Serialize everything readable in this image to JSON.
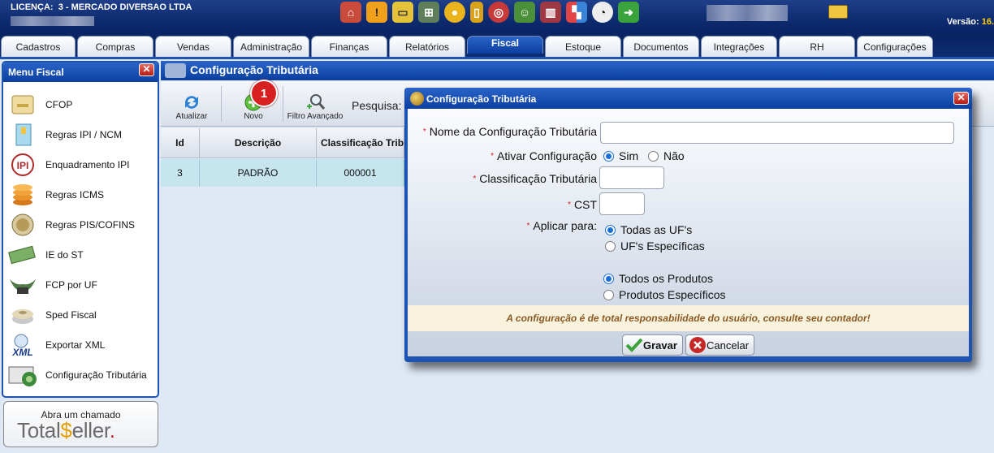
{
  "header": {
    "license_label": "LICENÇA:",
    "license_value": "3 - MERCADO DIVERSAO LTDA",
    "version_label": "Versão:",
    "version_value": "16."
  },
  "tabs": [
    {
      "label": "Cadastros"
    },
    {
      "label": "Compras"
    },
    {
      "label": "Vendas"
    },
    {
      "label": "Administração"
    },
    {
      "label": "Finanças"
    },
    {
      "label": "Relatórios"
    },
    {
      "label": "Fiscal"
    },
    {
      "label": "Estoque"
    },
    {
      "label": "Documentos"
    },
    {
      "label": "Integrações"
    },
    {
      "label": "RH"
    },
    {
      "label": "Configurações"
    }
  ],
  "active_tab": "Fiscal",
  "menu": {
    "title": "Menu Fiscal",
    "items": [
      {
        "label": "CFOP",
        "icon": "folder-icon"
      },
      {
        "label": "Regras IPI / NCM",
        "icon": "document-icon"
      },
      {
        "label": "Enquadramento IPI",
        "icon": "ipi-icon"
      },
      {
        "label": "Regras ICMS",
        "icon": "coins-icon"
      },
      {
        "label": "Regras PIS/COFINS",
        "icon": "coin-icon"
      },
      {
        "label": "IE do ST",
        "icon": "money-icon"
      },
      {
        "label": "FCP por UF",
        "icon": "wings-icon"
      },
      {
        "label": "Sped Fiscal",
        "icon": "disk-icon"
      },
      {
        "label": "Exportar XML",
        "icon": "xml-icon"
      },
      {
        "label": "Configuração Tributária",
        "icon": "config-tax-icon"
      }
    ]
  },
  "chamado": {
    "label": "Abra um chamado",
    "brand_left": "Total",
    "brand_s": "$",
    "brand_right": "eller",
    "brand_dot": "."
  },
  "main": {
    "title": "Configuração Tributária",
    "toolbar": {
      "refresh_label": "Atualizar",
      "new_label": "Novo",
      "new_badge": "1",
      "filter_label": "Filtro Avançado",
      "search_label": "Pesquisa:"
    },
    "grid": {
      "columns": [
        "Id",
        "Descrição",
        "Classificação Trib"
      ],
      "rows": [
        [
          "3",
          "PADRÃO",
          "000001"
        ]
      ]
    }
  },
  "dialog": {
    "title": "Configuração Tributária",
    "fields": {
      "name_label": "Nome da Configuração Tributária",
      "name_value": "",
      "active_label": "Ativar Configuração",
      "active_yes": "Sim",
      "active_no": "Não",
      "active_selected": "Sim",
      "class_label": "Classificação Tributária",
      "class_value": "",
      "cst_label": "CST",
      "cst_value": "",
      "apply_label": "Aplicar para:",
      "uf_all": "Todas as UF's",
      "uf_specific": "UF's Específicas",
      "uf_selected": "Todas as UF's",
      "prod_all": "Todos os Produtos",
      "prod_specific": "Produtos Específicos",
      "prod_selected": "Todos os Produtos"
    },
    "warning": "A configuração é de total responsabilidade do usuário, consulte seu contador!",
    "save_label": "Gravar",
    "cancel_label": "Cancelar"
  },
  "colors": {
    "brand_blue": "#1d54b3",
    "header_dark": "#0a2463",
    "selected_row": "#c6e5ee",
    "required_star": "#d21e1e",
    "warning_text": "#8a5a25",
    "badge_red": "#d72121"
  }
}
